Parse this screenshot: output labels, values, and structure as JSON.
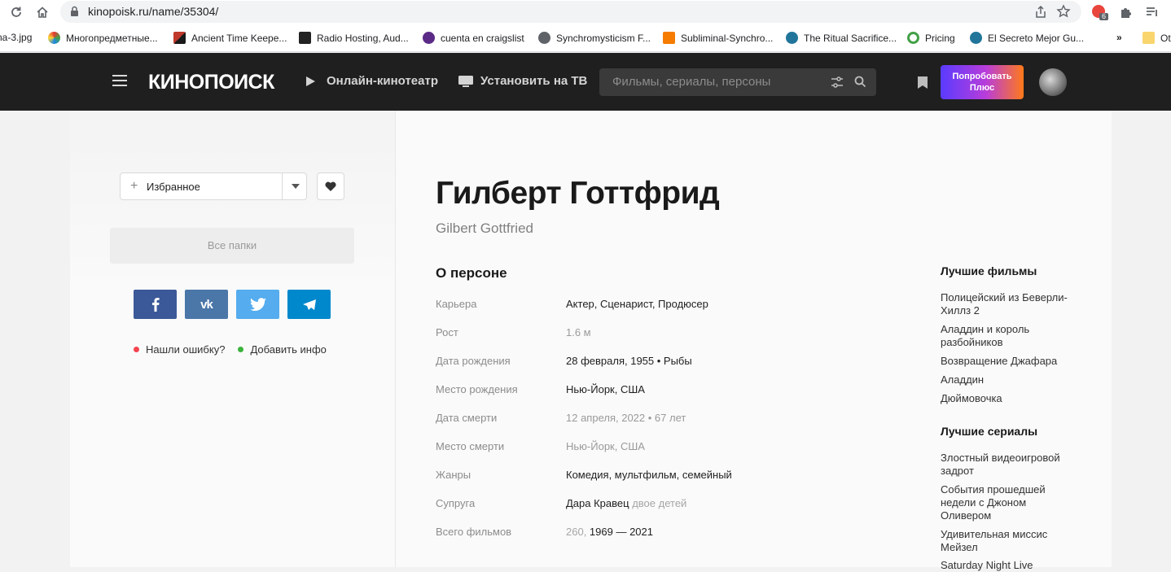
{
  "browser": {
    "url": "kinopoisk.ru/name/35304/",
    "ext_badge": "6",
    "bookmarks": [
      {
        "label": "na-3.jpg"
      },
      {
        "label": "Многопредметные..."
      },
      {
        "label": "Ancient Time Keepe..."
      },
      {
        "label": "Radio Hosting, Aud..."
      },
      {
        "label": "cuenta en craigslist"
      },
      {
        "label": "Synchromysticism F..."
      },
      {
        "label": "Subliminal-Synchro..."
      },
      {
        "label": "The Ritual Sacrifice..."
      },
      {
        "label": "Pricing"
      },
      {
        "label": "El Secreto Mejor Gu..."
      },
      {
        "label": "»"
      },
      {
        "label": "Ot"
      }
    ]
  },
  "header": {
    "logo": "КИНОПОИСК",
    "online": "Онлайн-кинотеатр",
    "tv": "Установить на ТВ",
    "search_placeholder": "Фильмы, сериалы, персоны",
    "plus_line1": "Попробовать",
    "plus_line2": "Плюс"
  },
  "left": {
    "favorite": "Избранное",
    "folders": "Все папки",
    "error": "Нашли ошибку?",
    "add_info": "Добавить инфо"
  },
  "person": {
    "name": "Гилберт Готтфрид",
    "original": "Gilbert Gottfried",
    "about_title": "О персоне",
    "rows": [
      {
        "k": "Карьера",
        "v": "Актер, Сценарист, Продюсер",
        "extra": ""
      },
      {
        "k": "Рост",
        "v": "1.6 м",
        "extra": ""
      },
      {
        "k": "Дата рождения",
        "v": "28 февраля, 1955 • Рыбы",
        "extra": ""
      },
      {
        "k": "Место рождения",
        "v": "Нью-Йорк, США",
        "extra": ""
      },
      {
        "k": "Дата смерти",
        "v": "12 апреля, 2022 • 67 лет",
        "extra": ""
      },
      {
        "k": "Место смерти",
        "v": "Нью-Йорк, США",
        "extra": ""
      },
      {
        "k": "Жанры",
        "v": "Комедия, мультфильм, семейный",
        "extra": ""
      },
      {
        "k": "Супруга",
        "v": "Дара Кравец",
        "extra": "двое детей"
      },
      {
        "k": "Всего фильмов",
        "v": "260, ",
        "extra": "1969 — 2021"
      }
    ]
  },
  "sidebar": {
    "best_films_title": "Лучшие фильмы",
    "best_films": [
      "Полицейский из Беверли-Хиллз 2",
      "Аладдин и король разбойников",
      "Возвращение Джафара",
      "Аладдин",
      "Дюймовочка"
    ],
    "best_series_title": "Лучшие сериалы",
    "best_series": [
      "Злостный видеоигровой задрот",
      "События прошедшей недели с Джоном Оливером",
      "Удивительная миссис Мейзел",
      "Saturday Night Live"
    ]
  },
  "colors": {
    "header_bg": "#1f1f1f",
    "facebook": "#3b5998",
    "vk": "#4a76a8",
    "twitter": "#55acee",
    "telegram": "#0088cc",
    "error_dot": "#f5444f",
    "add_dot": "#3bb33b"
  },
  "icons": {
    "share": "share-icon",
    "star": "star-icon",
    "heart": "heart-icon"
  }
}
